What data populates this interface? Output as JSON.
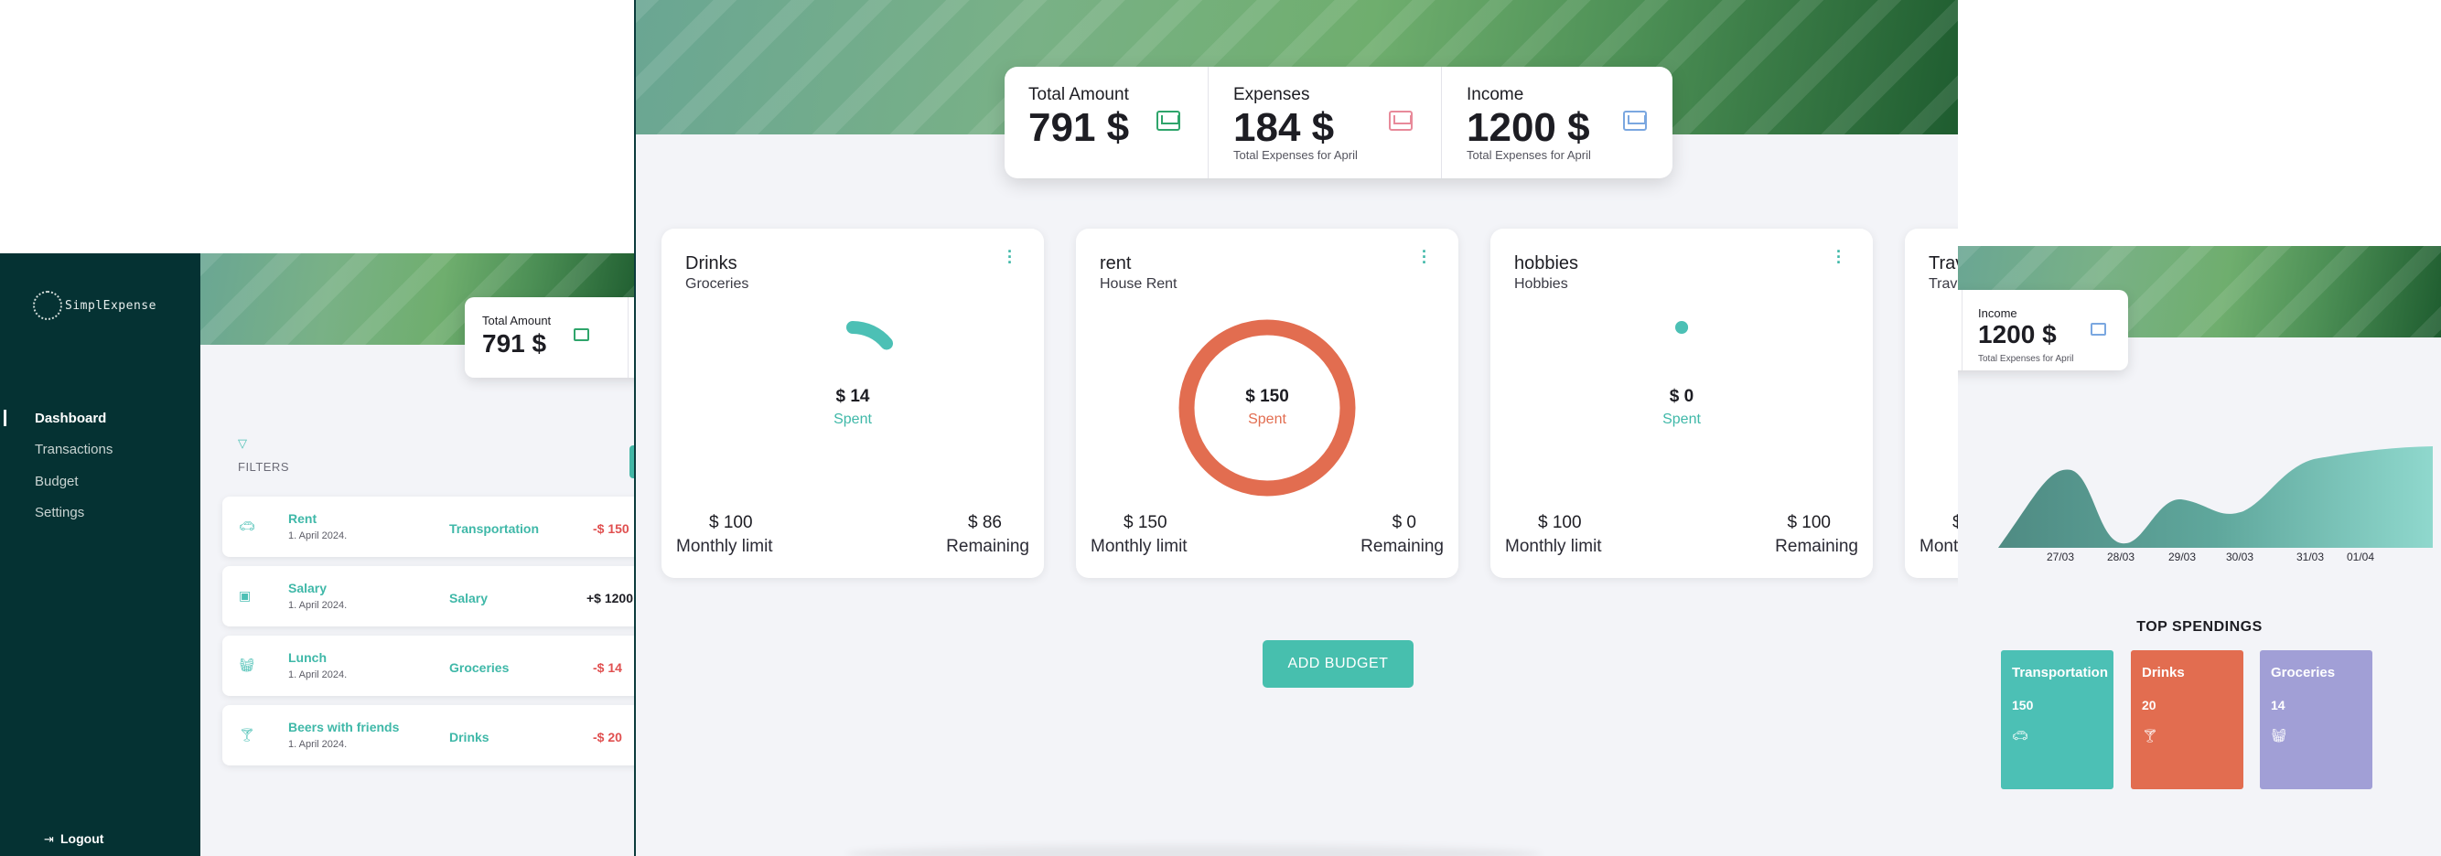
{
  "app": {
    "name": "SimplExpense"
  },
  "nav": {
    "items": [
      "Dashboard",
      "Transactions",
      "Budget",
      "Settings"
    ],
    "active": "Dashboard",
    "logout": "Logout"
  },
  "summary": {
    "total": {
      "label": "Total Amount",
      "value": "791 $"
    },
    "expenses": {
      "label": "Expenses",
      "value": "184 $",
      "sub": "Total Expenses for April"
    },
    "income": {
      "label": "Income",
      "value": "1200 $",
      "sub": "Total Expenses for April"
    }
  },
  "filters": {
    "label": "FILTERS"
  },
  "transactions": [
    {
      "name": "Rent",
      "date": "1. April 2024.",
      "category": "Transportation",
      "amount": "-$ 150",
      "icon": "car-icon"
    },
    {
      "name": "Salary",
      "date": "1. April 2024.",
      "category": "Salary",
      "amount": "+$ 1200",
      "icon": "cash-icon"
    },
    {
      "name": "Lunch",
      "date": "1. April 2024.",
      "category": "Groceries",
      "amount": "-$ 14",
      "icon": "basket-icon"
    },
    {
      "name": "Beers with friends",
      "date": "1. April 2024.",
      "category": "Drinks",
      "amount": "-$ 20",
      "icon": "cocktail-icon"
    }
  ],
  "budgets": [
    {
      "title": "Drinks",
      "subtitle": "Groceries",
      "spent": "$ 14",
      "spent_label": "Spent",
      "limit": "$ 100",
      "limit_label": "Monthly limit",
      "remaining": "$ 86",
      "remaining_label": "Remaining",
      "progress": 0.14,
      "color": "#4cc0b5"
    },
    {
      "title": "rent",
      "subtitle": "House Rent",
      "spent": "$ 150",
      "spent_label": "Spent",
      "limit": "$ 150",
      "limit_label": "Monthly limit",
      "remaining": "$ 0",
      "remaining_label": "Remaining",
      "progress": 1.0,
      "color": "#e26d50"
    },
    {
      "title": "hobbies",
      "subtitle": "Hobbies",
      "spent": "$ 0",
      "spent_label": "Spent",
      "limit": "$ 100",
      "limit_label": "Monthly limit",
      "remaining": "$ 100",
      "remaining_label": "Remaining",
      "progress": 0.0,
      "color": "#4cc0b5"
    },
    {
      "title": "Trav",
      "subtitle": "Trav",
      "limit": "$",
      "limit_label": "Mont"
    }
  ],
  "add_budget": "ADD BUDGET",
  "spending_chart": {
    "x_labels": [
      "27/03",
      "28/03",
      "29/03",
      "30/03",
      "31/03",
      "01/04"
    ]
  },
  "top_spendings": {
    "title": "TOP SPENDINGS",
    "items": [
      {
        "name": "Transportation",
        "value": "150",
        "icon": "car-icon",
        "color": "#4cc0b5"
      },
      {
        "name": "Drinks",
        "value": "20",
        "icon": "cocktail-icon",
        "color": "#e26d50"
      },
      {
        "name": "Groceries",
        "value": "14",
        "icon": "basket-icon",
        "color": "#a19fd6"
      }
    ]
  }
}
